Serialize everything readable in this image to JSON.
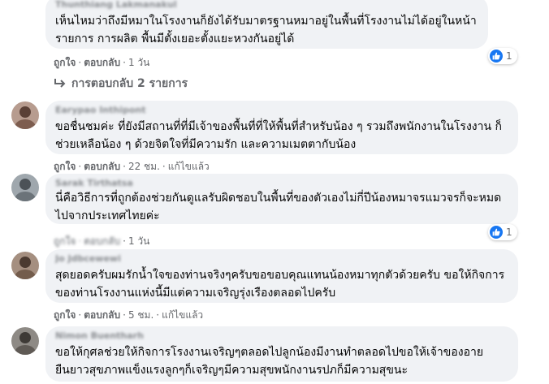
{
  "actions": {
    "like": "ถูกใจ",
    "reply": "ตอบกลับ",
    "edited": "แก้ไขแล้ว"
  },
  "comments": [
    {
      "author": "Thunthiang Lakmanakul",
      "text": "เห็นไหมว่าถึงมีหมาในโรงงานก็ยังได้รับมาตรฐานหมาอยู่ในพื้นที่โรงงานไม่ได้อยู่ในหน้า\nรายการ การผลิต พื้นมีตั้งเยอะตั้งแยะหวงกันอยู่ได้",
      "time": "1 วัน",
      "reactions": "1",
      "replies_label": "การตอบกลับ 2 รายการ"
    },
    {
      "author": "Earypao Inthipont",
      "text": "ขอชื่นชมค่ะ ที่ยังมีสถานที่ที่มีเจ้าของพื้นที่ที่ให้พื้นที่สำหรับน้อง ๆ รวมถึงพนักงานในโรงงาน ก็\nช่วยเหลือน้อง ๆ ด้วยจิตใจที่มีความรัก และความเมตตากับน้อง",
      "time": "22 ชม."
    },
    {
      "author": "Sarak Tirthatsa",
      "text": "นี่คือวิธีการที่ถูกต้องช่วยกันดูแลรับผิดชอบในพื้นที่ของตัวเองไม่กี่ปีน้องหมาจรแมวจรก็จะหมด\nไปจากประเทศไทยค่ะ",
      "time": "1 วัน",
      "reactions": "1"
    },
    {
      "author": "Jo Jdbcewewi",
      "text": "สุดยอดครับผมรักน้ำใจของท่านจริงๆครับขอขอบคุณแทนน้องหมาทุกตัวด้วยครับ ขอให้กิจการ\nของท่านโรงงานแห่งนี้มีแต่ความเจริญรุ่งเรืองตลอดไปครับ",
      "time": "5 ชม."
    },
    {
      "author": "Nimon Buentharh",
      "text": "ขอให้กุศลช่วยให้กิจการโรงงานเจริญๆตลอดไปลูกน้องมีงานทำตลอดไปขอให้เจ้าของอาย\nยืนยาวสุขภาพแข็งแรงลูกๆก็เจริญๆมีความสุขพนักงานรปภก็มีความสุขนะ"
    }
  ]
}
